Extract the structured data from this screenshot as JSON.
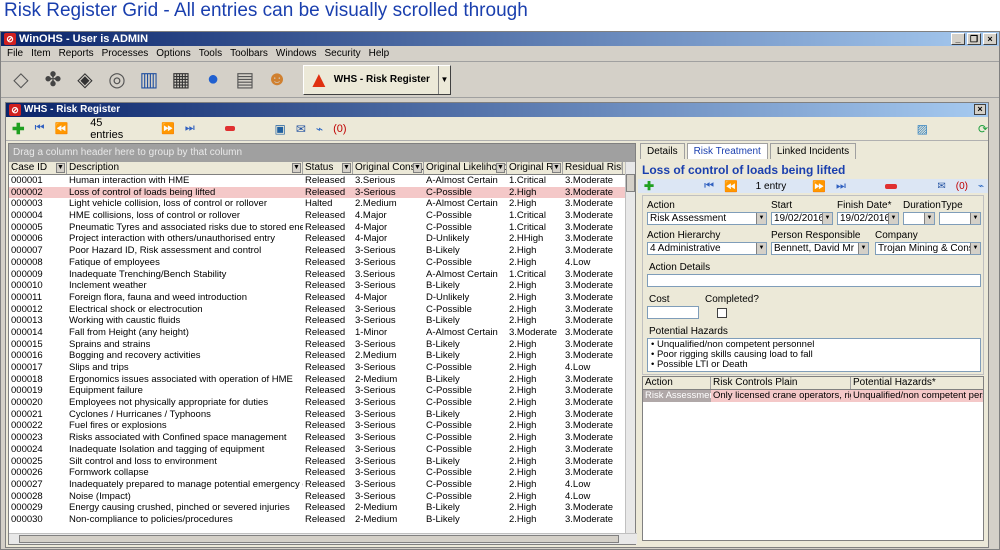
{
  "caption": "Risk Register Grid - All entries can be visually scrolled through",
  "app": {
    "title": "WinOHS - User is ADMIN",
    "menu": [
      "File",
      "Item",
      "Reports",
      "Processes",
      "Options",
      "Tools",
      "Toolbars",
      "Windows",
      "Security",
      "Help"
    ],
    "toolbar_icons": [
      "eraser-icon",
      "fan-icon",
      "compass-icon",
      "gauge-icon",
      "books-icon",
      "calculator-icon",
      "globe-icon",
      "money-icon",
      "person-icon"
    ],
    "module": "WHS - Risk Register"
  },
  "child": {
    "title": "WHS - Risk Register",
    "entries": "45 entries",
    "record_count": "(0)",
    "group_bar": "Drag a column header here to group by that column"
  },
  "grid": {
    "columns": [
      "Case ID",
      "Description",
      "Status",
      "Original Cons...",
      "Original Likelihood",
      "Original R...",
      "Residual Risk Le"
    ],
    "rows": [
      [
        "000001",
        "Human interaction with HME",
        "Released",
        "3.Serious",
        "A-Almost Certain",
        "1.Critical",
        "3.Moderate"
      ],
      [
        "000002",
        "Loss of control of loads being lifted",
        "Released",
        "3-Serious",
        "C-Possible",
        "2.High",
        "3.Moderate"
      ],
      [
        "000003",
        "Light vehicle collision, loss of control or rollover",
        "Halted",
        "2.Medium",
        "A-Almost Certain",
        "2.High",
        "3.Moderate"
      ],
      [
        "000004",
        "HME collisions, loss of control or rollover",
        "Released",
        "4.Major",
        "C-Possible",
        "1.Critical",
        "3.Moderate"
      ],
      [
        "000005",
        "Pneumatic Tyres and associated risks due to stored energy within",
        "Released",
        "4-Major",
        "C-Possible",
        "1.Critical",
        "3.Moderate"
      ],
      [
        "000006",
        "Project interaction with others/unauthorised entry",
        "Released",
        "4-Major",
        "D-Unlikely",
        "2.HHigh",
        "3.Moderate"
      ],
      [
        "000007",
        "Poor Hazard ID, Risk assessment and control",
        "Released",
        "3-Serious",
        "B-Likely",
        "2.High",
        "3.Moderate"
      ],
      [
        "000008",
        "Fatique of employees",
        "Released",
        "3-Serious",
        "C-Possible",
        "2.High",
        "4.Low"
      ],
      [
        "000009",
        "Inadequate Trenching/Bench Stability",
        "Released",
        "3.Serious",
        "A-Almost Certain",
        "1.Critical",
        "3.Moderate"
      ],
      [
        "000010",
        "Inclement weather",
        "Released",
        "3-Serious",
        "B-Likely",
        "2.High",
        "3.Moderate"
      ],
      [
        "000011",
        "Foreign flora, fauna and weed introduction",
        "Released",
        "4-Major",
        "D-Unlikely",
        "2.High",
        "3.Moderate"
      ],
      [
        "000012",
        "Electrical shock or electrocution",
        "Released",
        "3-Serious",
        "C-Possible",
        "2.High",
        "3.Moderate"
      ],
      [
        "000013",
        "Working with caustic fluids",
        "Released",
        "3-Serious",
        "B-Likely",
        "2.High",
        "3.Moderate"
      ],
      [
        "000014",
        "Fall from Height (any height)",
        "Released",
        "1-Minor",
        "A-Almost Certain",
        "3.Moderate",
        "3.Moderate"
      ],
      [
        "000015",
        "Sprains and strains",
        "Released",
        "3-Serious",
        "B-Likely",
        "2.High",
        "3.Moderate"
      ],
      [
        "000016",
        "Bogging and recovery activities",
        "Released",
        "2.Medium",
        "B-Likely",
        "2.High",
        "3.Moderate"
      ],
      [
        "000017",
        "Slips and trips",
        "Released",
        "3-Serious",
        "C-Possible",
        "2.High",
        "4.Low"
      ],
      [
        "000018",
        "Ergonomics issues associated with operation of HME",
        "Released",
        "2-Medium",
        "B-Likely",
        "2.High",
        "3.Moderate"
      ],
      [
        "000019",
        "Equipment failure",
        "Released",
        "3-Serious",
        "C-Possible",
        "2.High",
        "3.Moderate"
      ],
      [
        "000020",
        "Employees not physically appropriate for duties",
        "Released",
        "3-Serious",
        "C-Possible",
        "2.High",
        "3.Moderate"
      ],
      [
        "000021",
        "Cyclones / Hurricanes / Typhoons",
        "Released",
        "3-Serious",
        "B-Likely",
        "2.High",
        "3.Moderate"
      ],
      [
        "000022",
        "Fuel fires or explosions",
        "Released",
        "3-Serious",
        "C-Possible",
        "2.High",
        "3.Moderate"
      ],
      [
        "000023",
        "Risks associated with Confined space management",
        "Released",
        "3-Serious",
        "C-Possible",
        "2.High",
        "3.Moderate"
      ],
      [
        "000024",
        "Inadequate Isolation and tagging of equipment",
        "Released",
        "3-Serious",
        "C-Possible",
        "2.High",
        "3.Moderate"
      ],
      [
        "000025",
        "Silt control and loss to environment",
        "Released",
        "3-Serious",
        "B-Likely",
        "2.High",
        "3.Moderate"
      ],
      [
        "000026",
        "Formwork collapse",
        "Released",
        "3-Serious",
        "C-Possible",
        "2.High",
        "3.Moderate"
      ],
      [
        "000027",
        "Inadequately prepared to manage potential emergency event",
        "Released",
        "3-Serious",
        "C-Possible",
        "2.High",
        "4.Low"
      ],
      [
        "000028",
        "Noise (Impact)",
        "Released",
        "3-Serious",
        "C-Possible",
        "2.High",
        "4.Low"
      ],
      [
        "000029",
        "Energy causing crushed, pinched or severed injuries",
        "Released",
        "2-Medium",
        "B-Likely",
        "2.High",
        "3.Moderate"
      ],
      [
        "000030",
        "Non-compliance to policies/procedures",
        "Released",
        "2-Medium",
        "B-Likely",
        "2.High",
        "3.Moderate"
      ]
    ]
  },
  "detail": {
    "tabs": [
      "Details",
      "Risk Treatment",
      "Linked Incidents"
    ],
    "title": "Loss of control of loads being lifted",
    "entry_count": "1 entry",
    "record_count": "(0)",
    "labels": {
      "action": "Action",
      "start": "Start",
      "finish": "Finish Date*",
      "duration": "Duration",
      "type": "Type",
      "hierarchy": "Action Hierarchy",
      "person": "Person Responsible",
      "company": "Company",
      "details": "Action Details",
      "cost": "Cost",
      "completed": "Completed?",
      "hazards": "Potential Hazards"
    },
    "values": {
      "action": "Risk Assessment",
      "start": "19/02/2016",
      "finish": "19/02/2016",
      "hierarchy": "4 Administrative",
      "person": "Bennett, David Mr",
      "company": "Trojan Mining & Constructio"
    },
    "hazards": [
      "Unqualified/non competent personnel",
      "Poor rigging skills causing load to fall",
      "Possible LTI or Death"
    ],
    "sub_columns": [
      "Action",
      "Risk Controls Plain",
      "Potential Hazards*"
    ],
    "sub_row": [
      "Risk Assessment",
      "Only licensed crane operators, riggers",
      "Unqualified/non competent personnel"
    ]
  }
}
